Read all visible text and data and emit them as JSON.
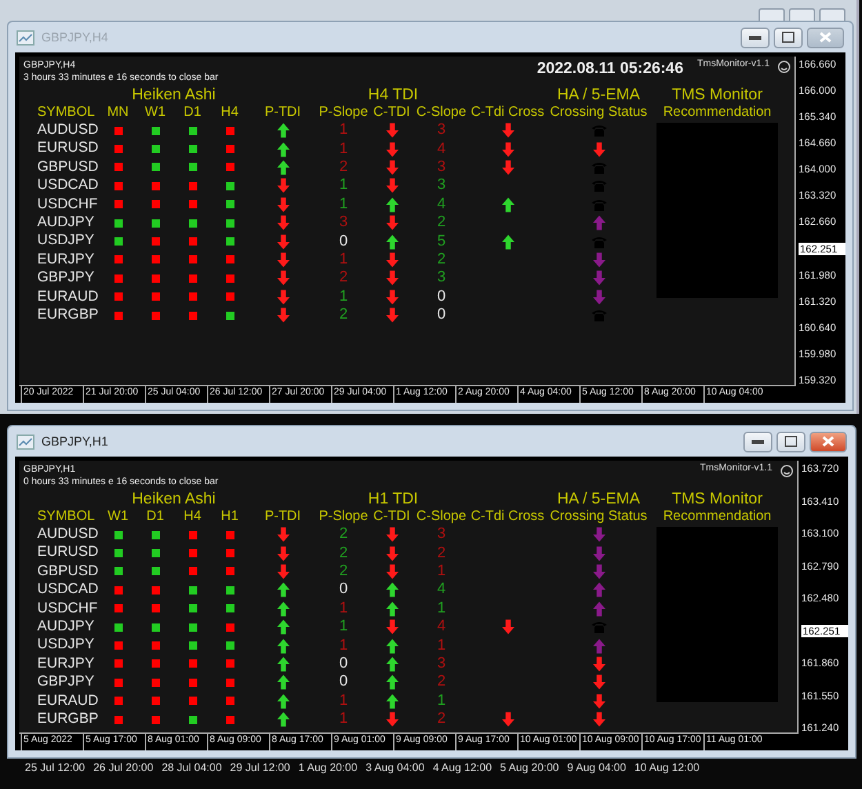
{
  "background": {
    "time_labels": [
      "25 Jul 12:00",
      "26 Jul 20:00",
      "28 Jul 04:00",
      "29 Jul 12:00",
      "1 Aug 20:00",
      "3 Aug 04:00",
      "4 Aug 12:00",
      "5 Aug 20:00",
      "9 Aug 04:00",
      "10 Aug 12:00"
    ]
  },
  "windows": [
    {
      "title": "GBPJPY,H4",
      "active": false,
      "chart_name": "GBPJPY,H4",
      "timer": "3 hours 33 minutes e 16 seconds to close bar",
      "timestamp": "2022.08.11 05:26:46",
      "indicator": "TmsMonitor-v1.1",
      "groups": [
        "Heiken Ashi",
        "H4 TDI",
        "HA / 5-EMA",
        "TMS Monitor"
      ],
      "columns": [
        "SYMBOL",
        "MN",
        "W1",
        "D1",
        "H4",
        "P-TDI",
        "P-Slope",
        "C-TDI",
        "C-Slope",
        "C-Tdi Cross",
        "Crossing Status",
        "Recommendation"
      ],
      "rows": [
        {
          "symbol": "AUDUSD",
          "ha": [
            {
              "bullish": false
            },
            {
              "bullish": true
            },
            {
              "bullish": true
            },
            {
              "bullish": false
            }
          ],
          "p_tdi": {
            "up": true
          },
          "p_slope": {
            "value": "1",
            "color": "#b01010"
          },
          "c_tdi": {
            "up": false
          },
          "c_slope": {
            "value": "3",
            "color": "#b01010"
          },
          "c_cross": {
            "up": false
          },
          "crossing": {
            "kind": "phone"
          }
        },
        {
          "symbol": "EURUSD",
          "ha": [
            {
              "bullish": false
            },
            {
              "bullish": true
            },
            {
              "bullish": true
            },
            {
              "bullish": false
            }
          ],
          "p_tdi": {
            "up": true
          },
          "p_slope": {
            "value": "1",
            "color": "#b01010"
          },
          "c_tdi": {
            "up": false
          },
          "c_slope": {
            "value": "4",
            "color": "#b01010"
          },
          "c_cross": {
            "up": false
          },
          "crossing": {
            "kind": "arrow",
            "up": false,
            "color": "#ff1a1a"
          }
        },
        {
          "symbol": "GBPUSD",
          "ha": [
            {
              "bullish": false
            },
            {
              "bullish": true
            },
            {
              "bullish": true
            },
            {
              "bullish": false
            }
          ],
          "p_tdi": {
            "up": true
          },
          "p_slope": {
            "value": "2",
            "color": "#b01010"
          },
          "c_tdi": {
            "up": false
          },
          "c_slope": {
            "value": "3",
            "color": "#b01010"
          },
          "c_cross": {
            "up": false
          },
          "crossing": {
            "kind": "phone"
          }
        },
        {
          "symbol": "USDCAD",
          "ha": [
            {
              "bullish": false
            },
            {
              "bullish": false
            },
            {
              "bullish": false
            },
            {
              "bullish": true
            }
          ],
          "p_tdi": {
            "up": false
          },
          "p_slope": {
            "value": "1",
            "color": "#20a020"
          },
          "c_tdi": {
            "up": false
          },
          "c_slope": {
            "value": "3",
            "color": "#20a020"
          },
          "crossing": {
            "kind": "phone"
          }
        },
        {
          "symbol": "USDCHF",
          "ha": [
            {
              "bullish": false
            },
            {
              "bullish": false
            },
            {
              "bullish": false
            },
            {
              "bullish": true
            }
          ],
          "p_tdi": {
            "up": false
          },
          "p_slope": {
            "value": "1",
            "color": "#20a020"
          },
          "c_tdi": {
            "up": true
          },
          "c_slope": {
            "value": "4",
            "color": "#20a020"
          },
          "c_cross": {
            "up": true
          },
          "crossing": {
            "kind": "phone"
          }
        },
        {
          "symbol": "AUDJPY",
          "ha": [
            {
              "bullish": true
            },
            {
              "bullish": true
            },
            {
              "bullish": true
            },
            {
              "bullish": true
            }
          ],
          "p_tdi": {
            "up": false
          },
          "p_slope": {
            "value": "3",
            "color": "#b01010"
          },
          "c_tdi": {
            "up": false
          },
          "c_slope": {
            "value": "2",
            "color": "#20a020"
          },
          "crossing": {
            "kind": "arrow",
            "up": true,
            "color": "#8a1a8a"
          }
        },
        {
          "symbol": "USDJPY",
          "ha": [
            {
              "bullish": true
            },
            {
              "bullish": false
            },
            {
              "bullish": false
            },
            {
              "bullish": true
            }
          ],
          "p_tdi": {
            "up": false
          },
          "p_slope": {
            "value": "0",
            "color": "#e6e6e6"
          },
          "c_tdi": {
            "up": true
          },
          "c_slope": {
            "value": "5",
            "color": "#20a020"
          },
          "c_cross": {
            "up": true
          },
          "crossing": {
            "kind": "phone"
          }
        },
        {
          "symbol": "EURJPY",
          "ha": [
            {
              "bullish": false
            },
            {
              "bullish": false
            },
            {
              "bullish": false
            },
            {
              "bullish": false
            }
          ],
          "p_tdi": {
            "up": false
          },
          "p_slope": {
            "value": "1",
            "color": "#b01010"
          },
          "c_tdi": {
            "up": false
          },
          "c_slope": {
            "value": "2",
            "color": "#20a020"
          },
          "crossing": {
            "kind": "arrow",
            "up": false,
            "color": "#8a1a8a"
          }
        },
        {
          "symbol": "GBPJPY",
          "ha": [
            {
              "bullish": false
            },
            {
              "bullish": false
            },
            {
              "bullish": false
            },
            {
              "bullish": false
            }
          ],
          "p_tdi": {
            "up": false
          },
          "p_slope": {
            "value": "2",
            "color": "#b01010"
          },
          "c_tdi": {
            "up": false
          },
          "c_slope": {
            "value": "3",
            "color": "#20a020"
          },
          "crossing": {
            "kind": "arrow",
            "up": false,
            "color": "#8a1a8a"
          }
        },
        {
          "symbol": "EURAUD",
          "ha": [
            {
              "bullish": false
            },
            {
              "bullish": false
            },
            {
              "bullish": false
            },
            {
              "bullish": false
            }
          ],
          "p_tdi": {
            "up": false
          },
          "p_slope": {
            "value": "1",
            "color": "#20a020"
          },
          "c_tdi": {
            "up": false
          },
          "c_slope": {
            "value": "0",
            "color": "#e6e6e6"
          },
          "crossing": {
            "kind": "arrow",
            "up": false,
            "color": "#8a1a8a"
          }
        },
        {
          "symbol": "EURGBP",
          "ha": [
            {
              "bullish": false
            },
            {
              "bullish": false
            },
            {
              "bullish": false
            },
            {
              "bullish": true
            }
          ],
          "p_tdi": {
            "up": false
          },
          "p_slope": {
            "value": "2",
            "color": "#20a020"
          },
          "c_tdi": {
            "up": false
          },
          "c_slope": {
            "value": "0",
            "color": "#e6e6e6"
          },
          "crossing": {
            "kind": "phone"
          }
        }
      ],
      "price_axis": [
        {
          "kind": "tick",
          "label": "166.660"
        },
        {
          "kind": "tick",
          "label": "166.000"
        },
        {
          "kind": "tick",
          "label": "165.340"
        },
        {
          "kind": "tick",
          "label": "164.660"
        },
        {
          "kind": "tick",
          "label": "164.000"
        },
        {
          "kind": "tick",
          "label": "163.320"
        },
        {
          "kind": "tick",
          "label": "162.660"
        },
        {
          "kind": "current",
          "label": "162.251"
        },
        {
          "kind": "tick",
          "label": "161.980"
        },
        {
          "kind": "tick",
          "label": "161.320"
        },
        {
          "kind": "tick",
          "label": "160.640"
        },
        {
          "kind": "tick",
          "label": "159.980"
        },
        {
          "kind": "tick",
          "label": "159.320"
        }
      ],
      "time_axis": [
        "20 Jul 2022",
        "21 Jul 20:00",
        "25 Jul 04:00",
        "26 Jul 12:00",
        "27 Jul 20:00",
        "29 Jul 04:00",
        "1 Aug 12:00",
        "2 Aug 20:00",
        "4 Aug 04:00",
        "5 Aug 12:00",
        "8 Aug 20:00",
        "10 Aug 04:00"
      ]
    },
    {
      "title": "GBPJPY,H1",
      "active": true,
      "chart_name": "GBPJPY,H1",
      "timer": "0 hours 33 minutes e 16 seconds to close bar",
      "indicator": "TmsMonitor-v1.1",
      "groups": [
        "Heiken Ashi",
        "H1 TDI",
        "HA / 5-EMA",
        "TMS Monitor"
      ],
      "columns": [
        "SYMBOL",
        "W1",
        "D1",
        "H4",
        "H1",
        "P-TDI",
        "P-Slope",
        "C-TDI",
        "C-Slope",
        "C-Tdi Cross",
        "Crossing Status",
        "Recommendation"
      ],
      "rows": [
        {
          "symbol": "AUDUSD",
          "ha": [
            {
              "bullish": true
            },
            {
              "bullish": true
            },
            {
              "bullish": false
            },
            {
              "bullish": false
            }
          ],
          "p_tdi": {
            "up": false
          },
          "p_slope": {
            "value": "2",
            "color": "#20a020"
          },
          "c_tdi": {
            "up": false
          },
          "c_slope": {
            "value": "3",
            "color": "#b01010"
          },
          "crossing": {
            "kind": "arrow",
            "up": false,
            "color": "#8a1a8a"
          }
        },
        {
          "symbol": "EURUSD",
          "ha": [
            {
              "bullish": true
            },
            {
              "bullish": true
            },
            {
              "bullish": false
            },
            {
              "bullish": false
            }
          ],
          "p_tdi": {
            "up": false
          },
          "p_slope": {
            "value": "2",
            "color": "#20a020"
          },
          "c_tdi": {
            "up": false
          },
          "c_slope": {
            "value": "2",
            "color": "#b01010"
          },
          "crossing": {
            "kind": "arrow",
            "up": false,
            "color": "#8a1a8a"
          }
        },
        {
          "symbol": "GBPUSD",
          "ha": [
            {
              "bullish": true
            },
            {
              "bullish": true
            },
            {
              "bullish": false
            },
            {
              "bullish": false
            }
          ],
          "p_tdi": {
            "up": false
          },
          "p_slope": {
            "value": "2",
            "color": "#20a020"
          },
          "c_tdi": {
            "up": false
          },
          "c_slope": {
            "value": "1",
            "color": "#b01010"
          },
          "crossing": {
            "kind": "arrow",
            "up": false,
            "color": "#8a1a8a"
          }
        },
        {
          "symbol": "USDCAD",
          "ha": [
            {
              "bullish": false
            },
            {
              "bullish": false
            },
            {
              "bullish": true
            },
            {
              "bullish": true
            }
          ],
          "p_tdi": {
            "up": true
          },
          "p_slope": {
            "value": "0",
            "color": "#e6e6e6"
          },
          "c_tdi": {
            "up": true
          },
          "c_slope": {
            "value": "4",
            "color": "#20a020"
          },
          "crossing": {
            "kind": "arrow",
            "up": true,
            "color": "#8a1a8a"
          }
        },
        {
          "symbol": "USDCHF",
          "ha": [
            {
              "bullish": false
            },
            {
              "bullish": false
            },
            {
              "bullish": true
            },
            {
              "bullish": true
            }
          ],
          "p_tdi": {
            "up": true
          },
          "p_slope": {
            "value": "1",
            "color": "#b01010"
          },
          "c_tdi": {
            "up": true
          },
          "c_slope": {
            "value": "1",
            "color": "#20a020"
          },
          "crossing": {
            "kind": "arrow",
            "up": true,
            "color": "#8a1a8a"
          }
        },
        {
          "symbol": "AUDJPY",
          "ha": [
            {
              "bullish": true
            },
            {
              "bullish": true
            },
            {
              "bullish": true
            },
            {
              "bullish": false
            }
          ],
          "p_tdi": {
            "up": true
          },
          "p_slope": {
            "value": "1",
            "color": "#20a020"
          },
          "c_tdi": {
            "up": false
          },
          "c_slope": {
            "value": "4",
            "color": "#b01010"
          },
          "c_cross": {
            "up": false
          },
          "crossing": {
            "kind": "phone"
          }
        },
        {
          "symbol": "USDJPY",
          "ha": [
            {
              "bullish": false
            },
            {
              "bullish": false
            },
            {
              "bullish": true
            },
            {
              "bullish": true
            }
          ],
          "p_tdi": {
            "up": true
          },
          "p_slope": {
            "value": "1",
            "color": "#b01010"
          },
          "c_tdi": {
            "up": true
          },
          "c_slope": {
            "value": "1",
            "color": "#b01010"
          },
          "crossing": {
            "kind": "arrow",
            "up": true,
            "color": "#8a1a8a"
          }
        },
        {
          "symbol": "EURJPY",
          "ha": [
            {
              "bullish": false
            },
            {
              "bullish": false
            },
            {
              "bullish": false
            },
            {
              "bullish": false
            }
          ],
          "p_tdi": {
            "up": true
          },
          "p_slope": {
            "value": "0",
            "color": "#e6e6e6"
          },
          "c_tdi": {
            "up": true
          },
          "c_slope": {
            "value": "3",
            "color": "#b01010"
          },
          "crossing": {
            "kind": "arrow",
            "up": false,
            "color": "#ff1a1a"
          }
        },
        {
          "symbol": "GBPJPY",
          "ha": [
            {
              "bullish": false
            },
            {
              "bullish": false
            },
            {
              "bullish": false
            },
            {
              "bullish": false
            }
          ],
          "p_tdi": {
            "up": true
          },
          "p_slope": {
            "value": "0",
            "color": "#e6e6e6"
          },
          "c_tdi": {
            "up": true
          },
          "c_slope": {
            "value": "2",
            "color": "#b01010"
          },
          "crossing": {
            "kind": "arrow",
            "up": false,
            "color": "#ff1a1a"
          }
        },
        {
          "symbol": "EURAUD",
          "ha": [
            {
              "bullish": false
            },
            {
              "bullish": false
            },
            {
              "bullish": false
            },
            {
              "bullish": false
            }
          ],
          "p_tdi": {
            "up": true
          },
          "p_slope": {
            "value": "1",
            "color": "#b01010"
          },
          "c_tdi": {
            "up": true
          },
          "c_slope": {
            "value": "1",
            "color": "#20a020"
          },
          "crossing": {
            "kind": "arrow",
            "up": false,
            "color": "#ff1a1a"
          }
        },
        {
          "symbol": "EURGBP",
          "ha": [
            {
              "bullish": false
            },
            {
              "bullish": false
            },
            {
              "bullish": true
            },
            {
              "bullish": false
            }
          ],
          "p_tdi": {
            "up": true
          },
          "p_slope": {
            "value": "1",
            "color": "#b01010"
          },
          "c_tdi": {
            "up": false
          },
          "c_slope": {
            "value": "2",
            "color": "#b01010"
          },
          "c_cross": {
            "up": false
          },
          "crossing": {
            "kind": "arrow",
            "up": false,
            "color": "#ff1a1a"
          }
        }
      ],
      "price_axis": [
        {
          "kind": "tick",
          "label": "163.720"
        },
        {
          "kind": "tick",
          "label": "163.410"
        },
        {
          "kind": "tick",
          "label": "163.100"
        },
        {
          "kind": "tick",
          "label": "162.790"
        },
        {
          "kind": "tick",
          "label": "162.480"
        },
        {
          "kind": "current",
          "label": "162.251"
        },
        {
          "kind": "tick",
          "label": "161.860"
        },
        {
          "kind": "tick",
          "label": "161.550"
        },
        {
          "kind": "tick",
          "label": "161.240"
        }
      ],
      "time_axis": [
        "5 Aug 2022",
        "5 Aug 17:00",
        "8 Aug 01:00",
        "8 Aug 09:00",
        "8 Aug 17:00",
        "9 Aug 01:00",
        "9 Aug 09:00",
        "9 Aug 17:00",
        "10 Aug 01:00",
        "10 Aug 09:00",
        "10 Aug 17:00",
        "11 Aug 01:00"
      ]
    }
  ]
}
